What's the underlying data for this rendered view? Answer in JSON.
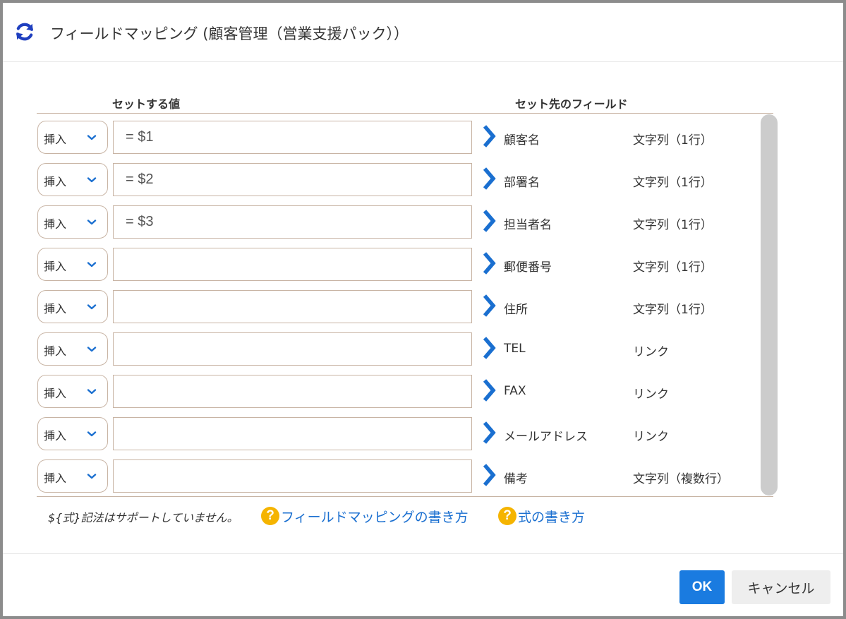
{
  "dialog": {
    "title": "フィールドマッピング (顧客管理（営業支援パック））",
    "icon": "refresh-icon"
  },
  "columns": {
    "value_header": "セットする値",
    "target_header": "セット先のフィールド"
  },
  "rows": [
    {
      "mode": "挿入",
      "value": "= $1",
      "field": "顧客名",
      "type": "文字列（1行）"
    },
    {
      "mode": "挿入",
      "value": "= $2",
      "field": "部署名",
      "type": "文字列（1行）"
    },
    {
      "mode": "挿入",
      "value": "= $3",
      "field": "担当者名",
      "type": "文字列（1行）"
    },
    {
      "mode": "挿入",
      "value": "",
      "field": "郵便番号",
      "type": "文字列（1行）"
    },
    {
      "mode": "挿入",
      "value": "",
      "field": "住所",
      "type": "文字列（1行）"
    },
    {
      "mode": "挿入",
      "value": "",
      "field": "TEL",
      "type": "リンク"
    },
    {
      "mode": "挿入",
      "value": "",
      "field": "FAX",
      "type": "リンク"
    },
    {
      "mode": "挿入",
      "value": "",
      "field": "メールアドレス",
      "type": "リンク"
    },
    {
      "mode": "挿入",
      "value": "",
      "field": "備考",
      "type": "文字列（複数行）"
    }
  ],
  "footer": {
    "note": "${式}記法はサポートしていません。",
    "help_links": [
      {
        "icon": "question-icon",
        "label": "フィールドマッピングの書き方"
      },
      {
        "icon": "question-icon",
        "label": "式の書き方"
      }
    ]
  },
  "buttons": {
    "ok": "OK",
    "cancel": "キャンセル"
  },
  "colors": {
    "accent": "#1a7be0",
    "arrow": "#1a6fd0",
    "help_icon": "#f5b400",
    "border": "#c8b4a4"
  }
}
